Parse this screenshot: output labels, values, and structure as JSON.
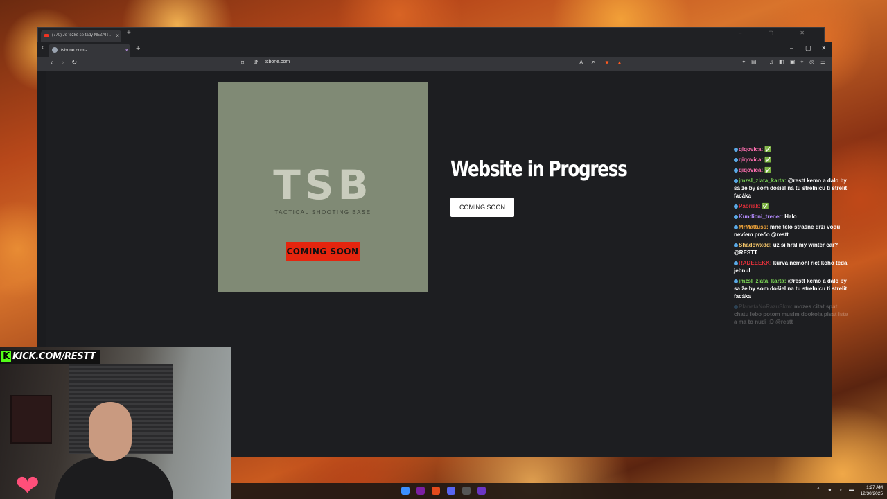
{
  "back_window": {
    "tab_title": "(770) Je těžké se tady NEZAP...",
    "new_tab": "+",
    "controls": "– ▢ ✕"
  },
  "browser": {
    "tab_title": "tsbone.com -",
    "tab_close": "×",
    "new_tab": "+",
    "url": "tsbone.com",
    "side_chevron": "‹",
    "win_minimize": "–",
    "win_maximize": "▢",
    "win_close": "✕",
    "nav_back": "‹",
    "nav_forward": "›",
    "reload": "↻"
  },
  "page": {
    "logo_text": "TSB",
    "logo_subtitle": "TACTICAL SHOOTING BASE",
    "badge": "COMING SOON",
    "headline": "Website in Progress",
    "cta": "COMING SOON",
    "card_color": "#808a75",
    "badge_color": "#e5250e"
  },
  "chat": [
    {
      "user": "qiqovica:",
      "text": "✅",
      "color": "#ff6fb0"
    },
    {
      "user": "qiqovica:",
      "text": "✅",
      "color": "#ff6fb0"
    },
    {
      "user": "qiqovica:",
      "text": "✅",
      "color": "#ff6fb0"
    },
    {
      "user": "jmzsl_zlata_karta:",
      "text": "@restt kemo a dalo by sa že by som došiel na tu strelnicu ti strelit facáka",
      "color": "#7ed957"
    },
    {
      "user": "Pabriak:",
      "text": "✅",
      "color": "#e0303a"
    },
    {
      "user": "Kundicni_trener:",
      "text": "Halo",
      "color": "#b58cff"
    },
    {
      "user": "MrMattuss:",
      "text": "mne telo strašne drži vodu nevíem prečo @restt",
      "color": "#f3a63a"
    },
    {
      "user": "Shadowxdd:",
      "text": "uz si hral my winter car? @RESTT",
      "color": "#f5c66a"
    },
    {
      "user": "RADEEEKK:",
      "text": "kurva nemohl rict koho teda jebnul",
      "color": "#e0303a"
    },
    {
      "user": "jmzsl_zlata_karta:",
      "text": "@restt kemo a dalo by sa že by som došiel na tu strelnicu ti strelit facáka",
      "color": "#7ed957"
    },
    {
      "user": "PlanetaNoRazuSkm:",
      "text": "mozes citat spat chatu lebo potom musim dookola pisat iste a ma to nudi :D @restt",
      "color": "#888888",
      "faded": true
    }
  ],
  "stream": {
    "kick_badge": "K",
    "kick_label": "KICK.COM/RESTT"
  },
  "taskbar": {
    "time": "1:27 AM",
    "date": "12/30/2025",
    "tray_chevron": "^"
  }
}
